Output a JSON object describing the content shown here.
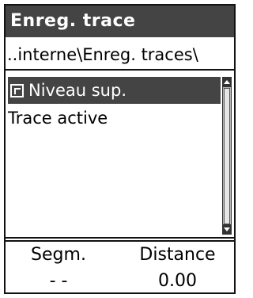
{
  "window": {
    "title": "Enreg. trace"
  },
  "path": {
    "text": "..interne\\Enreg. traces\\"
  },
  "list": {
    "items": [
      {
        "label": "Niveau sup.",
        "selected": true,
        "icon": "folder-up-icon"
      },
      {
        "label": "Trace active",
        "selected": false
      }
    ]
  },
  "summary": {
    "headers": {
      "segments": "Segm.",
      "distance": "Distance"
    },
    "values": {
      "segments": "- -",
      "distance": "0.00"
    }
  },
  "colors": {
    "title_bg": "#444444",
    "selection_bg": "#444444",
    "text": "#000000",
    "background": "#ffffff"
  }
}
